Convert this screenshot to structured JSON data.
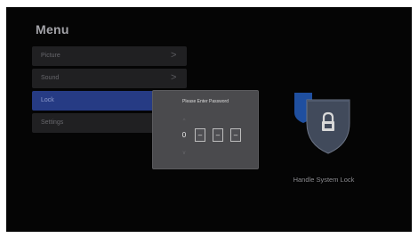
{
  "menu": {
    "title": "Menu",
    "items": [
      {
        "label": "Picture",
        "chevron": ">",
        "active": false
      },
      {
        "label": "Sound",
        "chevron": ">",
        "active": false
      },
      {
        "label": "Lock",
        "chevron": ">",
        "active": true
      },
      {
        "label": "Settings",
        "chevron": ">",
        "active": false
      }
    ]
  },
  "password_dialog": {
    "title": "Please Enter Password",
    "up_arrow": "^",
    "down_arrow": "v",
    "digits": [
      "0",
      "–",
      "–",
      "–"
    ],
    "focused_index": 0
  },
  "lock_panel": {
    "icon": "padlock-shield-icon",
    "caption": "Handle System Lock"
  },
  "colors": {
    "background": "#050505",
    "menu_item": "#202022",
    "menu_item_active": "#263b84",
    "dialog": "#4a4a4d",
    "shield_back": "#1f4fa0",
    "shield_front": "#414a5b"
  }
}
